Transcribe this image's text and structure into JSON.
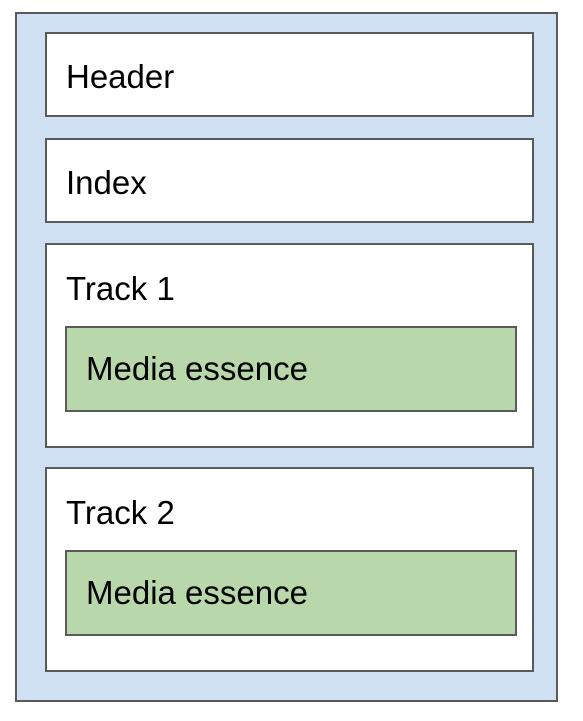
{
  "diagram": {
    "header_label": "Header",
    "index_label": "Index",
    "tracks": [
      {
        "label": "Track 1",
        "essence_label": "Media essence"
      },
      {
        "label": "Track 2",
        "essence_label": "Media essence"
      }
    ]
  }
}
